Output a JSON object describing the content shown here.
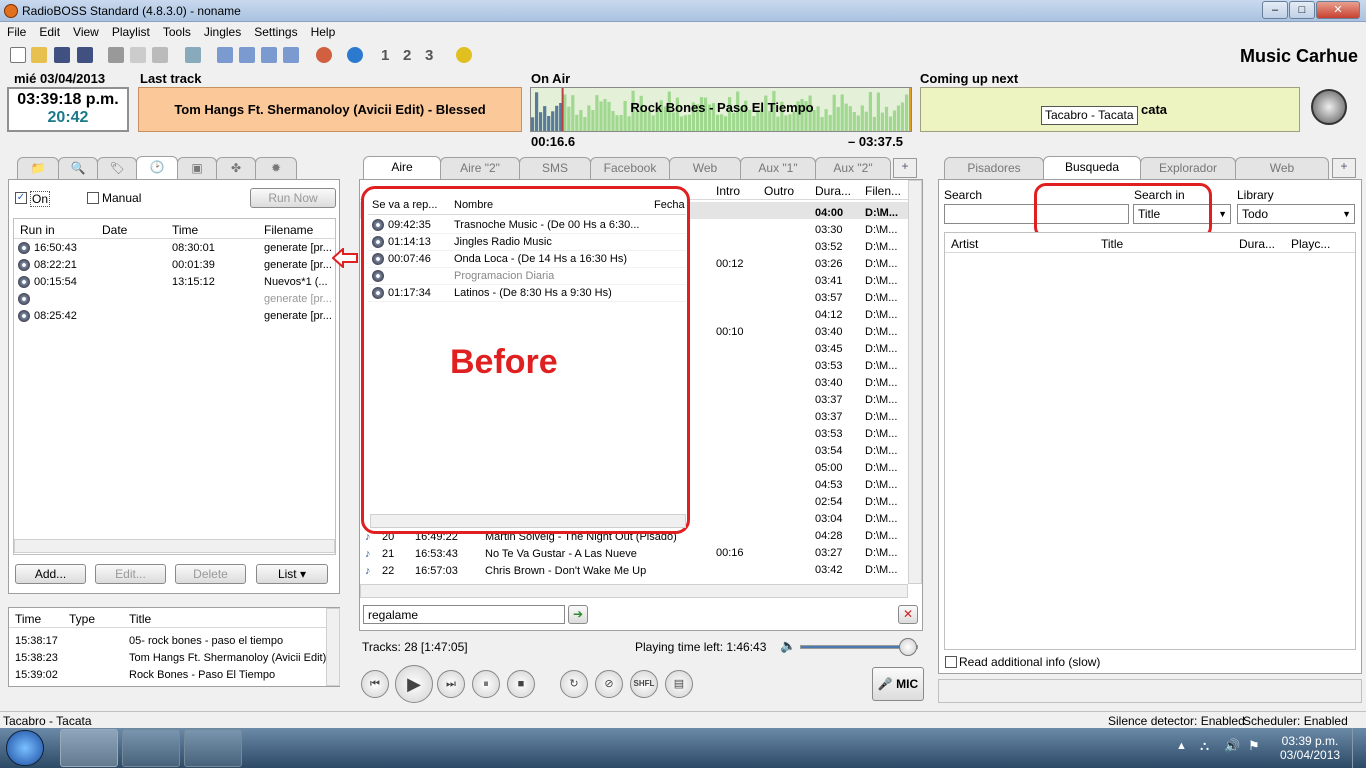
{
  "window": {
    "title": "RadioBOSS Standard (4.8.3.0) - noname",
    "minimize": "–",
    "maximize": "□",
    "close": "✕"
  },
  "menu": [
    "File",
    "Edit",
    "View",
    "Playlist",
    "Tools",
    "Jingles",
    "Settings",
    "Help"
  ],
  "toolbar": {
    "numbers": [
      "1",
      "2",
      "3"
    ]
  },
  "brand": "Music Carhue",
  "clock": {
    "date": "mié 03/04/2013",
    "time": "03:39:18 p.m.",
    "countdown": "20:42"
  },
  "last_track": {
    "label": "Last track",
    "title": "Tom Hangs Ft. Shermanoloy (Avicii Edit) - Blessed"
  },
  "on_air": {
    "label": "On Air",
    "title": "Rock Bones - Paso El Tiempo",
    "elapsed": "00:16.6",
    "remaining": "– 03:37.5",
    "progress": 0.08
  },
  "coming_up": {
    "label": "Coming up next",
    "title": "cata",
    "tooltip": "Tacabro - Tacata"
  },
  "scheduler": {
    "on_label": "On",
    "manual_label": "Manual",
    "run_now": "Run Now",
    "columns": [
      "Run in",
      "Date",
      "Time",
      "Filename"
    ],
    "rows": [
      {
        "run_in": "16:50:43",
        "date": "",
        "time": "08:30:01",
        "filename": "generate [pr..."
      },
      {
        "run_in": "08:22:21",
        "date": "",
        "time": "00:01:39",
        "filename": "generate [pr..."
      },
      {
        "run_in": "00:15:54",
        "date": "",
        "time": "13:15:12",
        "filename": "Nuevos*1 (..."
      },
      {
        "run_in": "",
        "date": "",
        "time": "",
        "filename": "generate [pr..."
      },
      {
        "run_in": "08:25:42",
        "date": "",
        "time": "",
        "filename": "generate [pr..."
      }
    ],
    "add": "Add...",
    "edit": "Edit...",
    "delete": "Delete",
    "list": "List"
  },
  "history": {
    "columns": [
      "Time",
      "Type",
      "Title"
    ],
    "rows": [
      {
        "time": "15:38:17",
        "type": "",
        "title": "05- rock bones - paso el tiempo"
      },
      {
        "time": "15:38:23",
        "type": "",
        "title": "Tom Hangs Ft. Shermanoloy (Avicii Edit)"
      },
      {
        "time": "15:39:02",
        "type": "",
        "title": "Rock Bones - Paso El Tiempo"
      }
    ]
  },
  "playlist_tabs": [
    "Aire",
    "Aire \"2\"",
    "SMS",
    "Facebook",
    "Web",
    "Aux \"1\"",
    "Aux \"2\""
  ],
  "playlist": {
    "columns": [
      "Intro",
      "Outro",
      "Dura...",
      "Filen..."
    ],
    "durations": [
      "04:00",
      "03:30",
      "03:52",
      "03:26",
      "03:41",
      "03:57",
      "04:12",
      "03:40",
      "03:45",
      "03:53",
      "03:40",
      "03:37",
      "03:37",
      "03:53",
      "03:54",
      "05:00",
      "04:53",
      "02:54",
      "03:04",
      "04:28",
      "03:27",
      "03:42"
    ],
    "file": "D:\\M...",
    "intros": {
      "3": "00:12",
      "7": "00:10",
      "20": "00:16"
    },
    "bottom_rows": [
      {
        "num": "20",
        "time": "16:49:22",
        "title": "Martin Solveig - The Night Out (Pisado)"
      },
      {
        "num": "21",
        "time": "16:53:43",
        "title": "No Te Va Gustar - A Las Nueve"
      },
      {
        "num": "22",
        "time": "16:57:03",
        "title": "Chris Brown - Don't Wake Me Up"
      }
    ],
    "search_value": "regalame",
    "tracks_info": "Tracks: 28 [1:47:05]",
    "playing_left": "Playing time left: 1:46:43",
    "volume": 0.92
  },
  "overlay": {
    "columns": [
      "Se va a rep...",
      "Nombre",
      "Fecha"
    ],
    "rows": [
      {
        "time": "09:42:35",
        "name": "Trasnoche Music  - (De 00 Hs a 6:30..."
      },
      {
        "time": "01:14:13",
        "name": "Jingles Radio Music"
      },
      {
        "time": "00:07:46",
        "name": "Onda Loca - (De 14 Hs a 16:30 Hs)"
      },
      {
        "time": "",
        "name": "Programacion Diaria"
      },
      {
        "time": "01:17:34",
        "name": "Latinos - (De 8:30 Hs a 9:30 Hs)"
      }
    ],
    "note": "Before"
  },
  "controls": {
    "shfl": "SHFL",
    "mic": "MIC"
  },
  "right_tabs": [
    "Pisadores",
    "Busqueda",
    "Explorador",
    "Web"
  ],
  "search": {
    "search_label": "Search",
    "search_in_label": "Search in",
    "search_in_value": "Title",
    "library_label": "Library",
    "library_value": "Todo",
    "columns": [
      "Artist",
      "Title",
      "Dura...",
      "Playc..."
    ],
    "read_info": "Read additional info (slow)"
  },
  "status": {
    "left": "Tacabro - Tacata",
    "silence": "Silence detector: Enabled",
    "scheduler": "Scheduler: Enabled"
  },
  "taskbar": {
    "time": "03:39 p.m.",
    "date": "03/04/2013"
  },
  "colors": {
    "last_track_bg": "#fbc89a",
    "coming_bg": "#eef3c2",
    "annotation": "#e02020"
  }
}
